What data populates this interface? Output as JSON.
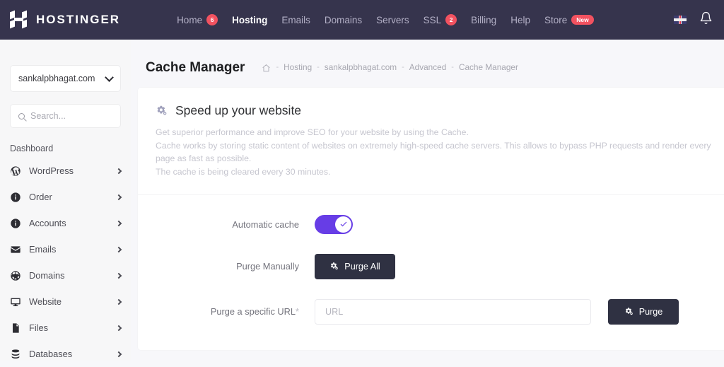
{
  "topnav": {
    "brand": "HOSTINGER",
    "links": [
      {
        "label": "Home",
        "badge": "6",
        "badge_type": "dot",
        "active": false
      },
      {
        "label": "Hosting",
        "badge": "",
        "badge_type": "",
        "active": true
      },
      {
        "label": "Emails",
        "badge": "",
        "badge_type": "",
        "active": false
      },
      {
        "label": "Domains",
        "badge": "",
        "badge_type": "",
        "active": false
      },
      {
        "label": "Servers",
        "badge": "",
        "badge_type": "",
        "active": false
      },
      {
        "label": "SSL",
        "badge": "2",
        "badge_type": "dot",
        "active": false
      },
      {
        "label": "Billing",
        "badge": "",
        "badge_type": "",
        "active": false
      },
      {
        "label": "Help",
        "badge": "",
        "badge_type": "",
        "active": false
      },
      {
        "label": "Store",
        "badge": "New",
        "badge_type": "pill",
        "active": false
      }
    ],
    "flag_icon": "uk-flag-icon",
    "bell_icon": "bell-icon",
    "background": "#36344d",
    "badge_color": "#f25260"
  },
  "sidebar": {
    "domain_selector": "sankalpbhagat.com",
    "search_placeholder": "Search...",
    "search_value": "",
    "heading": "Dashboard",
    "items": [
      {
        "label": "WordPress",
        "icon": "wordpress-icon"
      },
      {
        "label": "Order",
        "icon": "info-icon"
      },
      {
        "label": "Accounts",
        "icon": "info-icon"
      },
      {
        "label": "Emails",
        "icon": "envelope-icon"
      },
      {
        "label": "Domains",
        "icon": "globe-icon"
      },
      {
        "label": "Website",
        "icon": "monitor-icon"
      },
      {
        "label": "Files",
        "icon": "file-icon"
      },
      {
        "label": "Databases",
        "icon": "database-icon"
      }
    ]
  },
  "page": {
    "title": "Cache Manager",
    "breadcrumb": [
      {
        "label": "Hosting"
      },
      {
        "label": "sankalpbhagat.com"
      },
      {
        "label": "Advanced"
      },
      {
        "label": "Cache Manager"
      }
    ],
    "breadcrumb_separator": "-",
    "home_icon": "home-icon"
  },
  "card": {
    "icon": "cogs-icon",
    "title": "Speed up your website",
    "description": [
      "Get superior performance and improve SEO for your website by using the Cache.",
      "Cache works by storing static content of websites on extremely high-speed cache servers. This allows to bypass PHP requests and render every page as fast as possible.",
      "The cache is being cleared every 30 minutes."
    ],
    "rows": {
      "automatic_cache": {
        "label": "Automatic cache",
        "toggle_on": true,
        "toggle_color": "#673de6"
      },
      "purge_manually": {
        "label": "Purge Manually",
        "button_label": "Purge All",
        "button_icon": "cogs-icon",
        "button_color": "#2f3142"
      },
      "purge_url": {
        "label": "Purge a specific URL",
        "required_marker": "*",
        "input_placeholder": "URL",
        "input_value": "",
        "button_label": "Purge",
        "button_icon": "cogs-icon",
        "button_color": "#2f3142"
      }
    }
  }
}
